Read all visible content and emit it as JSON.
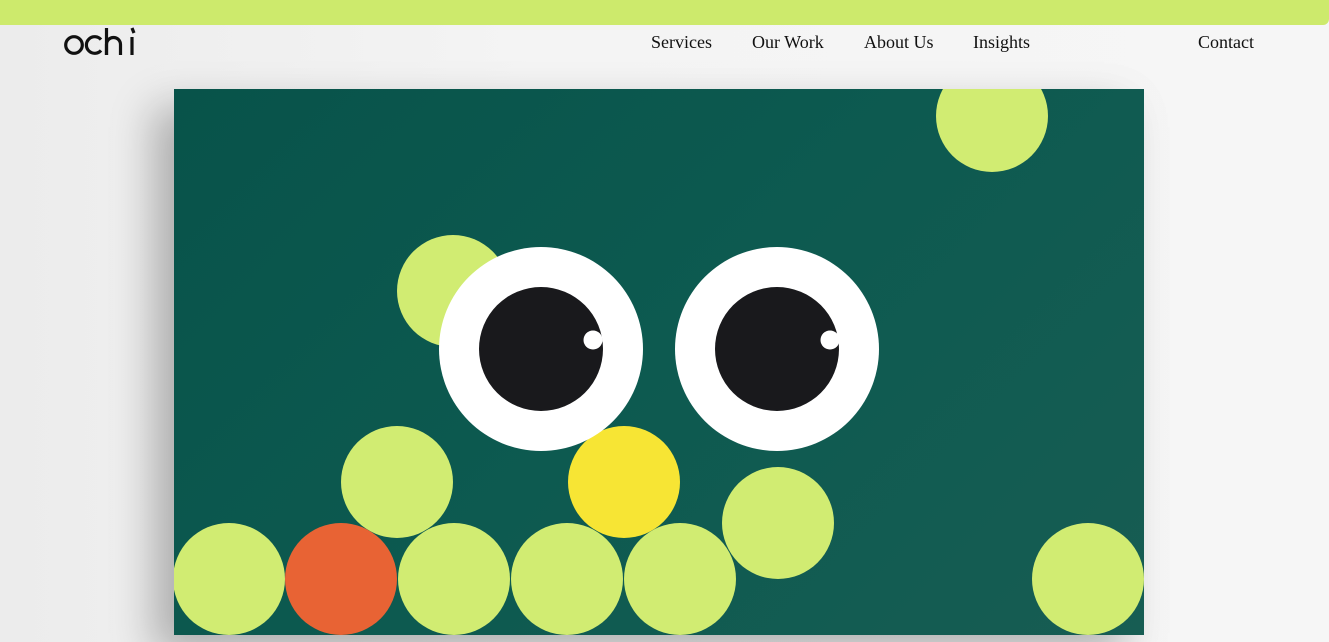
{
  "brand": {
    "logo_text": "ochi",
    "accent_color": "#cdea6c"
  },
  "nav": {
    "links": [
      {
        "label": "Services"
      },
      {
        "label": "Our Work"
      },
      {
        "label": "About Us"
      },
      {
        "label": "Insights"
      }
    ],
    "contact_label": "Contact"
  },
  "hero": {
    "background_color": "#0d5a50",
    "ball_colors": {
      "lime": "#d1ec72",
      "orange": "#e86334",
      "yellow": "#f7e534"
    },
    "eyes": {
      "sclera_color": "#ffffff",
      "pupil_color": "#19191c"
    }
  }
}
